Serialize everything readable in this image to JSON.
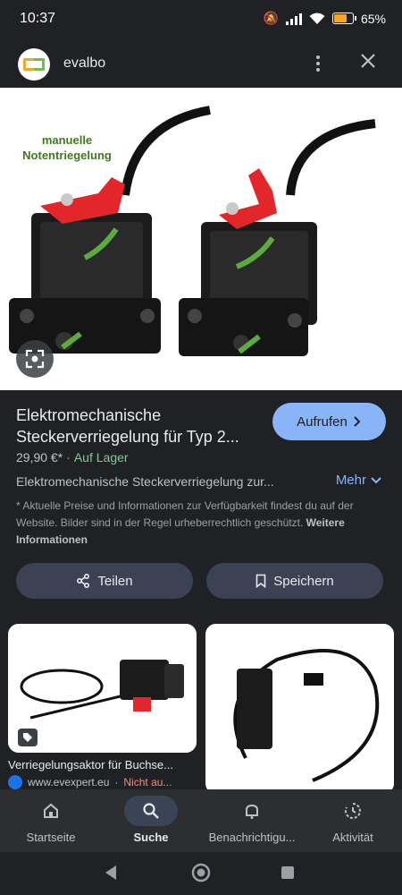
{
  "status": {
    "time": "10:37",
    "battery": "65%",
    "battery_level": 0.65
  },
  "header": {
    "site_name": "evalbo"
  },
  "hero": {
    "caption_line1": "manuelle",
    "caption_line2": "Notentriegelung"
  },
  "result": {
    "title": "Elektromechanische Steckerverriegelung für Typ 2...",
    "visit_label": "Aufrufen",
    "price": "29,90 €*",
    "stock": "Auf Lager",
    "description": "Elektromechanische Steckerverriegelung zur...",
    "more_label": "Mehr",
    "disclaimer": "* Aktuelle Preise und Informationen zur Verfügbarkeit findest du auf der Website. Bilder sind in der Regel urheberrechtlich geschützt.",
    "disclaimer_link": "Weitere Informationen"
  },
  "actions": {
    "share_label": "Teilen",
    "save_label": "Speichern"
  },
  "related": [
    {
      "title": "Verriegelungsaktor für Buchse...",
      "source": "www.evexpert.eu",
      "availability": "Nicht au..."
    }
  ],
  "nav": [
    {
      "label": "Startseite",
      "icon": "home-icon"
    },
    {
      "label": "Suche",
      "icon": "search-icon"
    },
    {
      "label": "Benachrichtigu...",
      "icon": "bell-icon"
    },
    {
      "label": "Aktivität",
      "icon": "activity-icon"
    }
  ],
  "colors": {
    "accent": "#8ab4f8",
    "stock": "#81c995",
    "unavailable": "#f28b82",
    "background": "#202124"
  }
}
